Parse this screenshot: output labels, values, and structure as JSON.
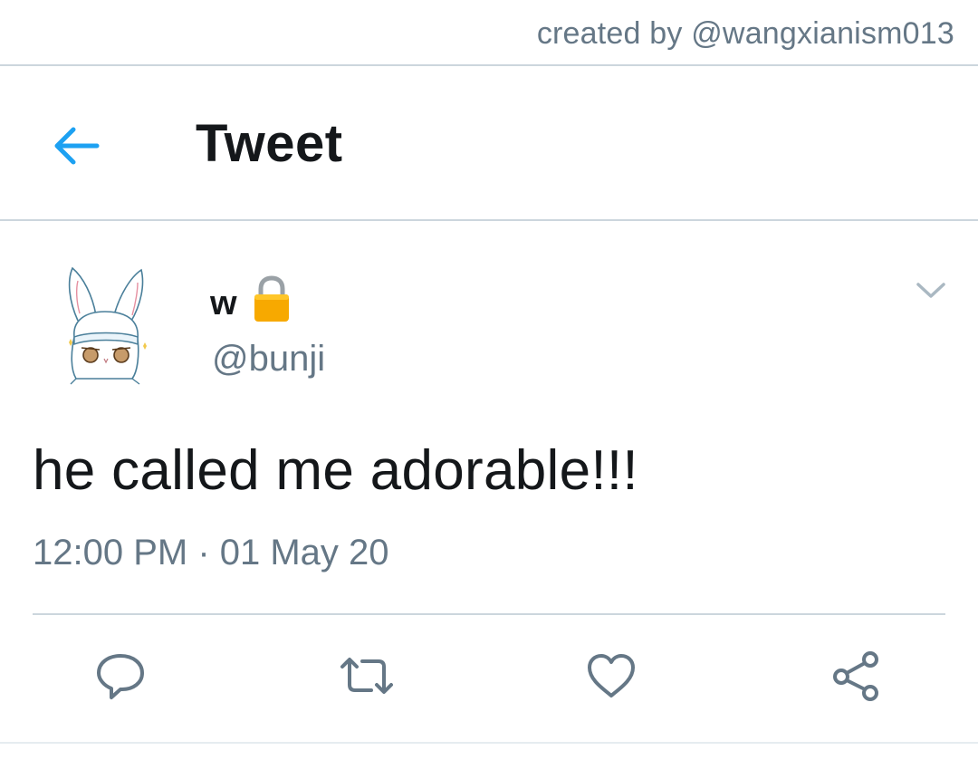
{
  "credit": "created by @wangxianism013",
  "header": {
    "title": "Tweet",
    "back_icon": "back-arrow-icon"
  },
  "colors": {
    "accent": "#1da1f2",
    "secondary_text": "#657786",
    "primary_text": "#14171a",
    "divider": "#ccd6dd",
    "lock": "#f7a900"
  },
  "tweet": {
    "display_name": "w",
    "protected_icon": "lock-icon",
    "handle": "@bunji",
    "text": "he called me adorable!!!",
    "timestamp": "12:00 PM · 01 May 20"
  },
  "actions": {
    "reply_icon": "reply-icon",
    "retweet_icon": "retweet-icon",
    "like_icon": "heart-icon",
    "share_icon": "share-icon",
    "more_icon": "chevron-down-icon"
  }
}
